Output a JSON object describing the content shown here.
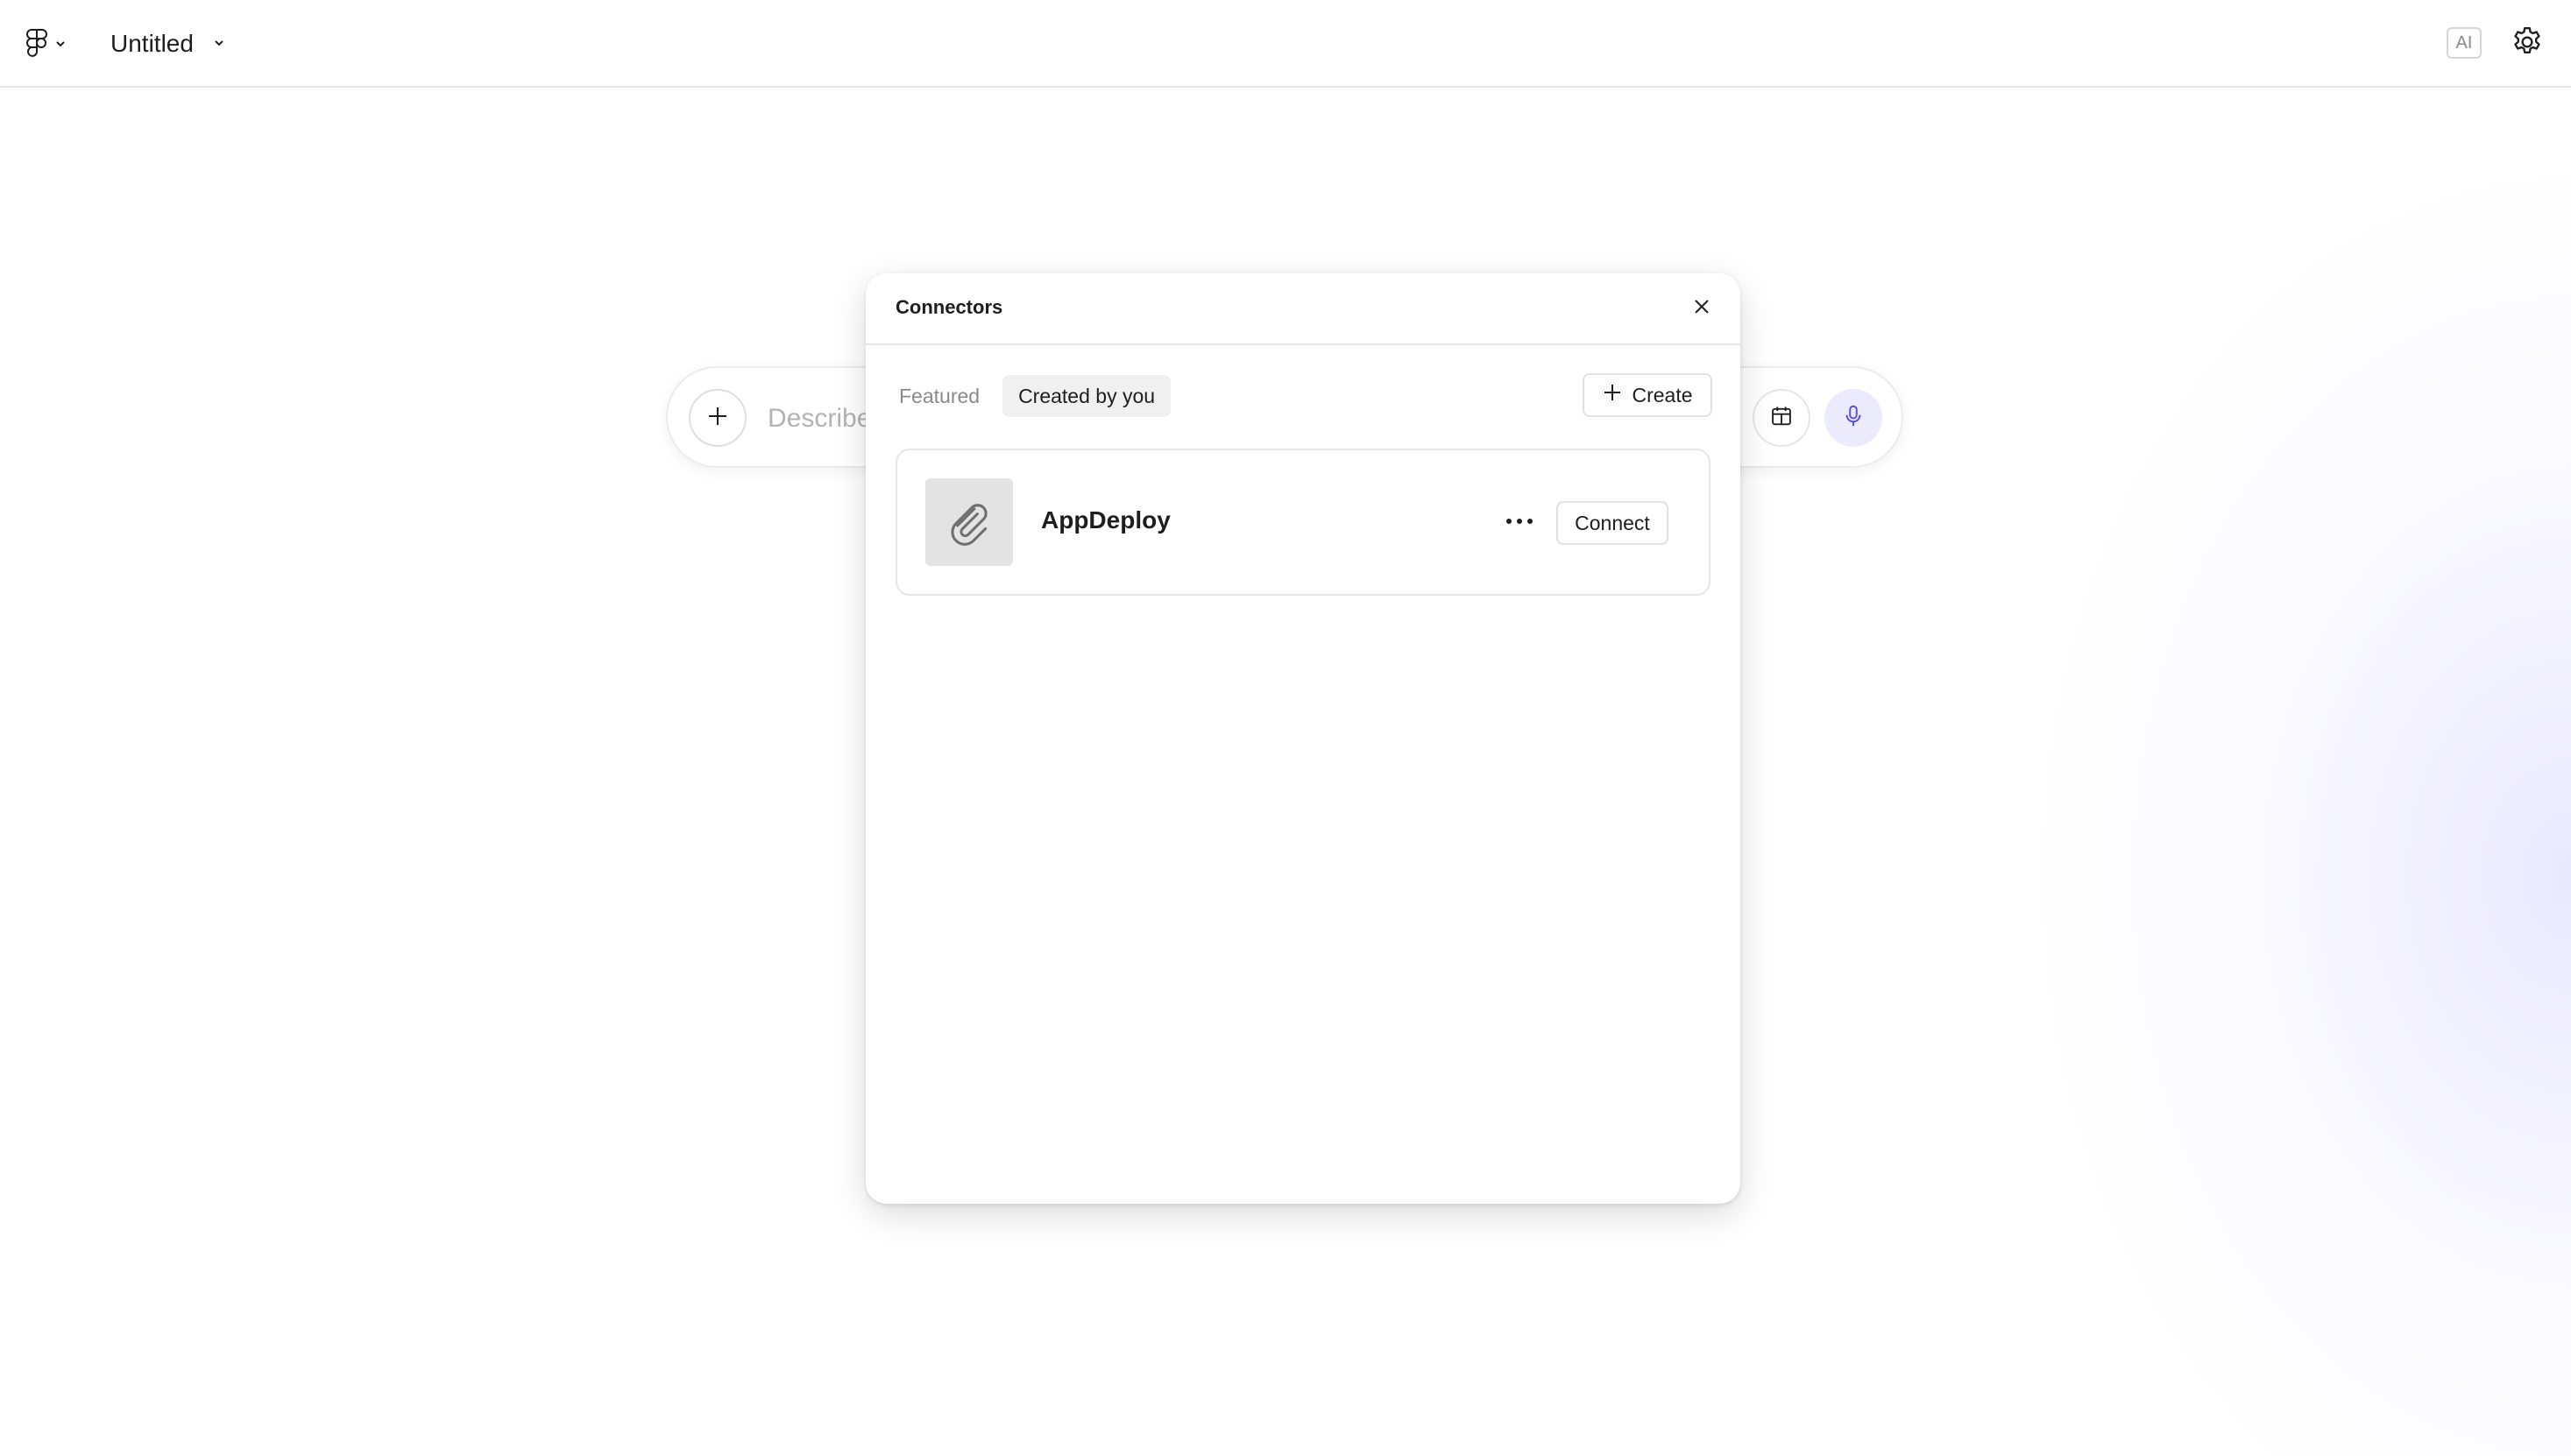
{
  "topbar": {
    "file_name": "Untitled",
    "ai_badge": "AI"
  },
  "prompt": {
    "placeholder": "Describe"
  },
  "modal": {
    "title": "Connectors",
    "tabs": [
      {
        "label": "Featured",
        "active": false
      },
      {
        "label": "Created by you",
        "active": true
      }
    ],
    "create_label": "Create",
    "connectors": [
      {
        "name": "AppDeploy",
        "icon": "paperclip-icon",
        "action_label": "Connect"
      }
    ]
  },
  "colors": {
    "accent_mic_bg": "#ecebfd",
    "accent_mic_icon": "#5b4fe0",
    "text": "#1e1e1e",
    "muted": "#8a8a8a"
  }
}
